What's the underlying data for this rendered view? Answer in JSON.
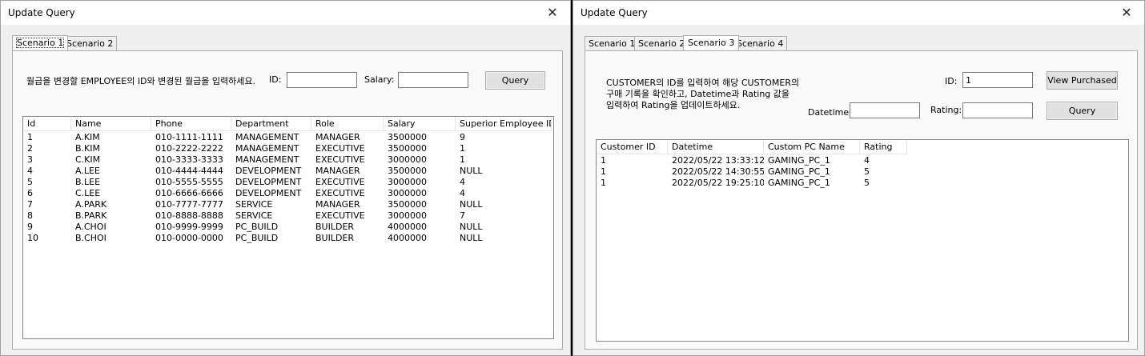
{
  "w1": {
    "title": "Update Query",
    "tabs": [
      "Scenario 1",
      "Scenario 2"
    ],
    "instruction": "월급을 변경할 EMPLOYEE의 ID와 변경된 월급을 입력하세요.",
    "id_label": "ID:",
    "id_value": "",
    "salary_label": "Salary:",
    "salary_value": "",
    "query_button": "Query",
    "columns": [
      "Id",
      "Name",
      "Phone",
      "Department",
      "Role",
      "Salary",
      "Superior Employee ID"
    ],
    "rows": [
      [
        "1",
        "A.KIM",
        "010-1111-1111",
        "MANAGEMENT",
        "MANAGER",
        "3500000",
        "9"
      ],
      [
        "2",
        "B.KIM",
        "010-2222-2222",
        "MANAGEMENT",
        "EXECUTIVE",
        "3500000",
        "1"
      ],
      [
        "3",
        "C.KIM",
        "010-3333-3333",
        "MANAGEMENT",
        "EXECUTIVE",
        "3000000",
        "1"
      ],
      [
        "4",
        "A.LEE",
        "010-4444-4444",
        "DEVELOPMENT",
        "MANAGER",
        "3500000",
        "NULL"
      ],
      [
        "5",
        "B.LEE",
        "010-5555-5555",
        "DEVELOPMENT",
        "EXECUTIVE",
        "3000000",
        "4"
      ],
      [
        "6",
        "C.LEE",
        "010-6666-6666",
        "DEVELOPMENT",
        "EXECUTIVE",
        "3000000",
        "4"
      ],
      [
        "7",
        "A.PARK",
        "010-7777-7777",
        "SERVICE",
        "MANAGER",
        "3500000",
        "NULL"
      ],
      [
        "8",
        "B.PARK",
        "010-8888-8888",
        "SERVICE",
        "EXECUTIVE",
        "3000000",
        "7"
      ],
      [
        "9",
        "A.CHOI",
        "010-9999-9999",
        "PC_BUILD",
        "BUILDER",
        "4000000",
        "NULL"
      ],
      [
        "10",
        "B.CHOI",
        "010-0000-0000",
        "PC_BUILD",
        "BUILDER",
        "4000000",
        "NULL"
      ]
    ]
  },
  "w2": {
    "title": "Update Query",
    "tabs": [
      "Scenario 1",
      "Scenario 2",
      "Scenario 3",
      "Scenario 4"
    ],
    "instruction_lines": [
      "CUSTOMER의 ID를 입력하여 해당 CUSTOMER의",
      "구매 기록을 확인하고, Datetime과 Rating 값을",
      "입력하여 Rating을 업데이트하세요."
    ],
    "id_label": "ID:",
    "id_value": "1",
    "view_button": "View Purchased",
    "datetime_label": "Datetime:",
    "datetime_value": "",
    "rating_label": "Rating:",
    "rating_value": "",
    "query_button": "Query",
    "columns": [
      "Customer ID",
      "Datetime",
      "Custom PC Name",
      "Rating"
    ],
    "rows": [
      [
        "1",
        "2022/05/22 13:33:12",
        "GAMING_PC_1",
        "4"
      ],
      [
        "1",
        "2022/05/22 14:30:55",
        "GAMING_PC_1",
        "5"
      ],
      [
        "1",
        "2022/05/22 19:25:10",
        "GAMING_PC_1",
        "5"
      ]
    ]
  }
}
